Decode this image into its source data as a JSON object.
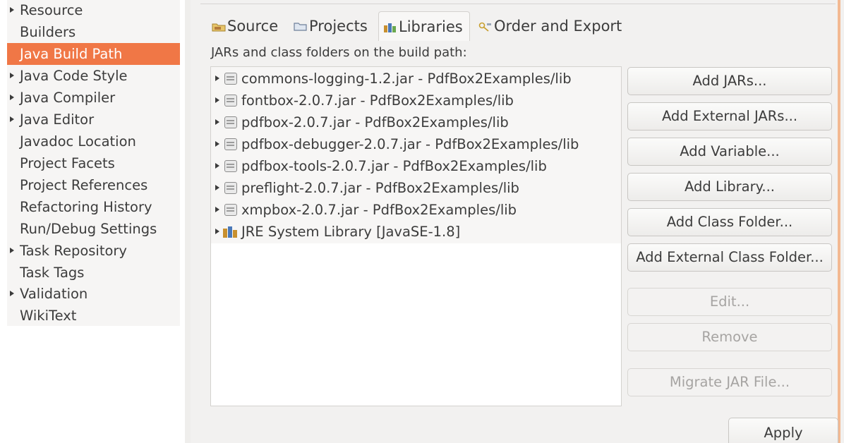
{
  "sidebar": {
    "items": [
      {
        "label": "Resource",
        "expandable": true,
        "selected": false
      },
      {
        "label": "Builders",
        "expandable": false,
        "selected": false
      },
      {
        "label": "Java Build Path",
        "expandable": false,
        "selected": true
      },
      {
        "label": "Java Code Style",
        "expandable": true,
        "selected": false
      },
      {
        "label": "Java Compiler",
        "expandable": true,
        "selected": false
      },
      {
        "label": "Java Editor",
        "expandable": true,
        "selected": false
      },
      {
        "label": "Javadoc Location",
        "expandable": false,
        "selected": false
      },
      {
        "label": "Project Facets",
        "expandable": false,
        "selected": false
      },
      {
        "label": "Project References",
        "expandable": false,
        "selected": false
      },
      {
        "label": "Refactoring History",
        "expandable": false,
        "selected": false
      },
      {
        "label": "Run/Debug Settings",
        "expandable": false,
        "selected": false
      },
      {
        "label": "Task Repository",
        "expandable": true,
        "selected": false
      },
      {
        "label": "Task Tags",
        "expandable": false,
        "selected": false
      },
      {
        "label": "Validation",
        "expandable": true,
        "selected": false
      },
      {
        "label": "WikiText",
        "expandable": false,
        "selected": false
      }
    ]
  },
  "tabs": [
    {
      "label": "Source",
      "icon": "source-folder-icon",
      "active": false
    },
    {
      "label": "Projects",
      "icon": "projects-icon",
      "active": false
    },
    {
      "label": "Libraries",
      "icon": "libraries-icon",
      "active": true
    },
    {
      "label": "Order and Export",
      "icon": "order-export-icon",
      "active": false
    }
  ],
  "main": {
    "section_label": "JARs and class folders on the build path:"
  },
  "tree": {
    "rows": [
      {
        "label": "commons-logging-1.2.jar - PdfBox2Examples/lib",
        "icon": "jar-icon"
      },
      {
        "label": "fontbox-2.0.7.jar - PdfBox2Examples/lib",
        "icon": "jar-icon"
      },
      {
        "label": "pdfbox-2.0.7.jar - PdfBox2Examples/lib",
        "icon": "jar-icon"
      },
      {
        "label": "pdfbox-debugger-2.0.7.jar - PdfBox2Examples/lib",
        "icon": "jar-icon"
      },
      {
        "label": "pdfbox-tools-2.0.7.jar - PdfBox2Examples/lib",
        "icon": "jar-icon"
      },
      {
        "label": "preflight-2.0.7.jar - PdfBox2Examples/lib",
        "icon": "jar-icon"
      },
      {
        "label": "xmpbox-2.0.7.jar - PdfBox2Examples/lib",
        "icon": "jar-icon"
      },
      {
        "label": "JRE System Library [JavaSE-1.8]",
        "icon": "library-icon"
      }
    ]
  },
  "buttons": {
    "add_jars": "Add JARs...",
    "add_external_jars": "Add External JARs...",
    "add_variable": "Add Variable...",
    "add_library": "Add Library...",
    "add_class_folder": "Add Class Folder...",
    "add_external_class_folder": "Add External Class Folder...",
    "edit": "Edit...",
    "remove": "Remove",
    "migrate_jar": "Migrate JAR File...",
    "apply": "Apply"
  },
  "colors": {
    "selection": "#f07746",
    "panel_bg": "#f2f1f0",
    "disabled_text": "#a6a4a2"
  }
}
